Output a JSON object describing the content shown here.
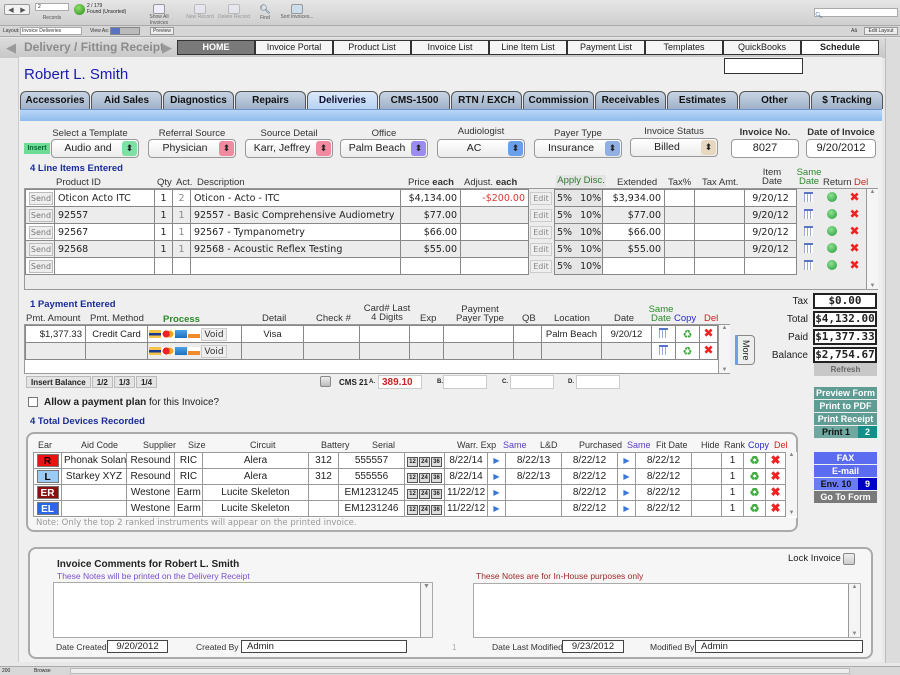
{
  "toolbar": {
    "record_value": "2",
    "records_label": "Records",
    "found_count": "2 / 179",
    "found_status": "Found (Unsorted)",
    "show_all": "Show All Invoices",
    "new_record": "New Record",
    "delete_record": "Delete Record",
    "find": "Find",
    "sort": "Sort Invoices...",
    "layout_label": "Layout:",
    "layout_value": "Invoice Deliveries",
    "view_as": "View As:",
    "preview": "Preview",
    "aa": "Aâ",
    "edit_layout": "Edit Layout"
  },
  "header": {
    "title": "Delivery / Fitting Receipt",
    "nav": [
      "HOME",
      "Invoice Portal",
      "Product List",
      "Invoice List",
      "Line Item List",
      "Payment List",
      "Templates",
      "QuickBooks",
      "Schedule"
    ]
  },
  "patient_name": "Robert L. Smith",
  "module_tabs": [
    "Accessories",
    "Aid Sales",
    "Diagnostics",
    "Repairs",
    "Deliveries",
    "CMS-1500",
    "RTN / EXCH",
    "Commission",
    "Receivables",
    "Estimates",
    "Other",
    "$ Tracking"
  ],
  "active_tab": "Deliveries",
  "selectors": {
    "insert": "Insert",
    "template": {
      "label": "Select a Template",
      "value": "Audio and"
    },
    "referral": {
      "label": "Referral Source",
      "value": "Physician"
    },
    "source_detail": {
      "label": "Source Detail",
      "value": "Karr, Jeffrey"
    },
    "office": {
      "label": "Office",
      "value": "Palm Beach"
    },
    "audiologist": {
      "label": "Audiologist",
      "value": "AC"
    },
    "payer_type": {
      "label": "Payer Type",
      "value": "Insurance"
    },
    "invoice_status": {
      "label": "Invoice Status",
      "value": "Billed"
    },
    "invoice_no": {
      "label": "Invoice No.",
      "value": "8027"
    },
    "invoice_date": {
      "label": "Date of Invoice",
      "value": "9/20/2012"
    }
  },
  "line_items": {
    "title": "4 Line Items Entered",
    "headers": {
      "product_id": "Product ID",
      "qty": "Qty",
      "act": "Act.",
      "description": "Description",
      "price": "Price",
      "price_bold": "each",
      "adjust": "Adjust.",
      "adjust_bold": "each",
      "apply_disc": "Apply Disc.",
      "extended": "Extended",
      "tax_pct": "Tax%",
      "tax_amt": "Tax Amt.",
      "item_date": "Item Date",
      "same_date": "Same Date",
      "return": "Return",
      "del": "Del"
    },
    "send": "Send",
    "edit": "Edit",
    "disc5": "5%",
    "disc10": "10%",
    "rows": [
      {
        "product_id": "Oticon Acto ITC",
        "qty": "1",
        "act": "2",
        "description": "Oticon - Acto - ITC",
        "price": "$4,134.00",
        "adjust": "-$200.00",
        "extended": "$3,934.00",
        "tax_pct": "",
        "tax_amt": "",
        "date": "9/20/12"
      },
      {
        "product_id": "92557",
        "qty": "1",
        "act": "1",
        "description": "92557 - Basic Comprehensive Audiometry",
        "price": "$77.00",
        "adjust": "",
        "extended": "$77.00",
        "tax_pct": "",
        "tax_amt": "",
        "date": "9/20/12"
      },
      {
        "product_id": "92567",
        "qty": "1",
        "act": "1",
        "description": "92567 - Tympanometry",
        "price": "$66.00",
        "adjust": "",
        "extended": "$66.00",
        "tax_pct": "",
        "tax_amt": "",
        "date": "9/20/12"
      },
      {
        "product_id": "92568",
        "qty": "1",
        "act": "1",
        "description": "92568 - Acoustic Reflex Testing",
        "price": "$55.00",
        "adjust": "",
        "extended": "$55.00",
        "tax_pct": "",
        "tax_amt": "",
        "date": "9/20/12"
      },
      {
        "product_id": "",
        "qty": "",
        "act": "",
        "description": "",
        "price": "",
        "adjust": "",
        "extended": "",
        "tax_pct": "",
        "tax_amt": "",
        "date": ""
      }
    ]
  },
  "payments": {
    "title": "1 Payment Entered",
    "headers": {
      "amount": "Pmt. Amount",
      "method": "Pmt. Method",
      "process": "Process",
      "detail": "Detail",
      "check": "Check #",
      "card4": "Card# Last 4 Digits",
      "exp": "Exp",
      "payer_type": "Payment Payer Type",
      "qb": "QB",
      "location": "Location",
      "date": "Date",
      "same_date": "Same Date",
      "copy": "Copy",
      "del": "Del"
    },
    "void": "Void",
    "more": "More",
    "rows": [
      {
        "amount": "$1,377.33",
        "method": "Credit Card",
        "detail": "Visa",
        "check": "",
        "card4": "",
        "exp": "",
        "payer_type": "",
        "qb": "",
        "location": "Palm Beach",
        "date": "9/20/12"
      },
      {
        "amount": "",
        "method": "",
        "detail": "",
        "check": "",
        "card4": "",
        "exp": "",
        "payer_type": "",
        "qb": "",
        "location": "",
        "date": ""
      }
    ],
    "split_buttons": [
      "Insert Balance",
      "1/2",
      "1/3",
      "1/4"
    ],
    "cms21_label": "CMS 21",
    "cms_a_label": "A.",
    "cms_a_value": "389.10",
    "cms_b_label": "B.",
    "cms_c_label": "C.",
    "cms_d_label": "D.",
    "payment_plan_bold": "Allow a payment plan",
    "payment_plan_rest": " for this Invoice?"
  },
  "totals": {
    "tax_label": "Tax",
    "tax": "$0.00",
    "total_label": "Total",
    "total": "$4,132.00",
    "paid_label": "Paid",
    "paid": "$1,377.33",
    "balance_label": "Balance",
    "balance": "$2,754.67",
    "refresh": "Refresh"
  },
  "side_buttons": {
    "preview_form": "Preview Form",
    "print_pdf": "Print to PDF",
    "print_receipt": "Print Receipt",
    "print1": "Print 1",
    "print_count": "2",
    "fax": "FAX",
    "email": "E-mail",
    "env10": "Env. 10",
    "env_count": "9",
    "go_to_form": "Go To Form"
  },
  "devices": {
    "title": "4 Total Devices Recorded",
    "headers": {
      "ear": "Ear",
      "aid_code": "Aid Code",
      "supplier": "Supplier",
      "size": "Size",
      "circuit": "Circuit",
      "battery": "Battery",
      "serial": "Serial",
      "warr_exp": "Warr. Exp",
      "same1": "Same",
      "ld": "L&D",
      "purchased": "Purchased",
      "same2": "Same",
      "fit_date": "Fit Date",
      "hide": "Hide",
      "rank": "Rank",
      "copy": "Copy",
      "del": "Del"
    },
    "warr_options": [
      "12",
      "24",
      "36"
    ],
    "rows": [
      {
        "ear": "R",
        "ear_color": "#ee1111",
        "ear_text": "#000000",
        "aid_code": "Phonak Solana",
        "supplier": "Resound",
        "size": "RIC",
        "circuit": "Alera",
        "battery": "312",
        "serial": "555557",
        "warr_exp": "8/22/14",
        "ld": "8/22/13",
        "purchased": "8/22/12",
        "fit_date": "8/22/12",
        "hide": "",
        "rank": "1"
      },
      {
        "ear": "L",
        "ear_color": "#9ccbf4",
        "ear_text": "#000000",
        "aid_code": "Starkey XYZ",
        "supplier": "Resound",
        "size": "RIC",
        "circuit": "Alera",
        "battery": "312",
        "serial": "555556",
        "warr_exp": "8/22/14",
        "ld": "8/22/13",
        "purchased": "8/22/12",
        "fit_date": "8/22/12",
        "hide": "",
        "rank": "1"
      },
      {
        "ear": "ER",
        "ear_color": "#8b1010",
        "ear_text": "#ffffff",
        "aid_code": "",
        "supplier": "Westone",
        "size": "Earm",
        "circuit": "Lucite Skeleton",
        "battery": "",
        "serial": "EM1231245",
        "warr_exp": "11/22/12",
        "ld": "",
        "purchased": "8/22/12",
        "fit_date": "8/22/12",
        "hide": "",
        "rank": "1"
      },
      {
        "ear": "EL",
        "ear_color": "#2a66e8",
        "ear_text": "#ffffff",
        "aid_code": "",
        "supplier": "Westone",
        "size": "Earm",
        "circuit": "Lucite Skeleton",
        "battery": "",
        "serial": "EM1231246",
        "warr_exp": "11/22/12",
        "ld": "",
        "purchased": "8/22/12",
        "fit_date": "8/22/12",
        "hide": "",
        "rank": "1"
      }
    ],
    "note": "Note: Only the top 2 ranked instruments will appear on the printed invoice."
  },
  "comments": {
    "title": "Invoice Comments for Robert L. Smith",
    "printed_note": "These Notes will be printed on the Delivery Receipt",
    "inhouse_note": "These Notes are for In-House purposes only",
    "lock_label": "Lock Invoice",
    "date_created_label": "Date Created",
    "date_created": "9/20/2012",
    "created_by_label": "Created By",
    "created_by": "Admin",
    "page_num": "1",
    "date_modified_label": "Date Last Modified",
    "date_modified": "9/23/2012",
    "modified_by_label": "Modified By",
    "modified_by": "Admin"
  },
  "statusbar": {
    "zoom": "200",
    "mode": "Browse"
  },
  "colors": {
    "accent_blue": "#1a2c99",
    "green_btn": "#5e9c94",
    "blue_btn": "#5b6cf0",
    "dark_blue": "#0000c8",
    "teal": "#138f8a"
  }
}
